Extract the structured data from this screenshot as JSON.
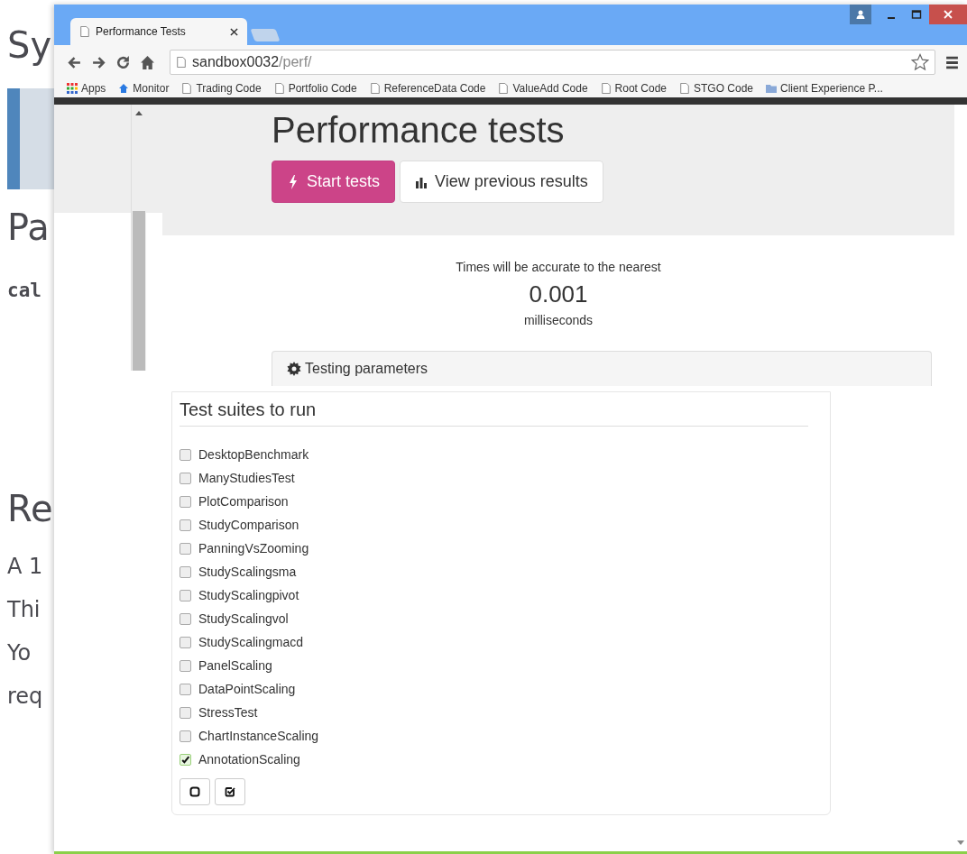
{
  "document": {
    "lines": [
      {
        "kind": "heading",
        "text": "Sy"
      },
      {
        "kind": "banner"
      },
      {
        "kind": "heading",
        "text": "Pa"
      },
      {
        "kind": "code",
        "text": "cal"
      },
      {
        "kind": "heading",
        "text": "Re"
      },
      {
        "kind": "body",
        "text": "A 1"
      },
      {
        "kind": "body",
        "text": "Thi"
      },
      {
        "kind": "body",
        "text": "Yo"
      },
      {
        "kind": "body",
        "text": "req"
      }
    ]
  },
  "browser": {
    "tab": {
      "title": "Performance Tests"
    },
    "address": {
      "host": "sandbox0032",
      "path": "/perf/"
    },
    "bookmarks": [
      {
        "kind": "apps",
        "label": "Apps"
      },
      {
        "kind": "site",
        "label": "Monitor"
      },
      {
        "kind": "page",
        "label": "Trading Code"
      },
      {
        "kind": "page",
        "label": "Portfolio Code"
      },
      {
        "kind": "page",
        "label": "ReferenceData Code"
      },
      {
        "kind": "page",
        "label": "ValueAdd Code"
      },
      {
        "kind": "page",
        "label": "Root Code"
      },
      {
        "kind": "page",
        "label": "STGO Code"
      },
      {
        "kind": "folder",
        "label": "Client Experience P..."
      }
    ]
  },
  "page": {
    "heading": "Performance tests",
    "buttons": [
      {
        "kind": "bolt",
        "label": "Start tests",
        "primary": true
      },
      {
        "kind": "bars",
        "label": "View previous results",
        "primary": false
      }
    ],
    "accuracy": {
      "intro": "Times will be accurate to the nearest",
      "value": "0.001",
      "unit": "milliseconds"
    },
    "parameters": {
      "title": "Testing parameters"
    },
    "suites": {
      "title": "Test suites to run",
      "items": [
        {
          "label": "DesktopBenchmark",
          "checked": false
        },
        {
          "label": "ManyStudiesTest",
          "checked": false
        },
        {
          "label": "PlotComparison",
          "checked": false
        },
        {
          "label": "StudyComparison",
          "checked": false
        },
        {
          "label": "PanningVsZooming",
          "checked": false
        },
        {
          "label": "StudyScalingsma",
          "checked": false
        },
        {
          "label": "StudyScalingpivot",
          "checked": false
        },
        {
          "label": "StudyScalingvol",
          "checked": false
        },
        {
          "label": "StudyScalingmacd",
          "checked": false
        },
        {
          "label": "PanelScaling",
          "checked": false
        },
        {
          "label": "DataPointScaling",
          "checked": false
        },
        {
          "label": "StressTest",
          "checked": false
        },
        {
          "label": "ChartInstanceScaling",
          "checked": false
        },
        {
          "label": "AnnotationScaling",
          "checked": true
        }
      ]
    }
  }
}
